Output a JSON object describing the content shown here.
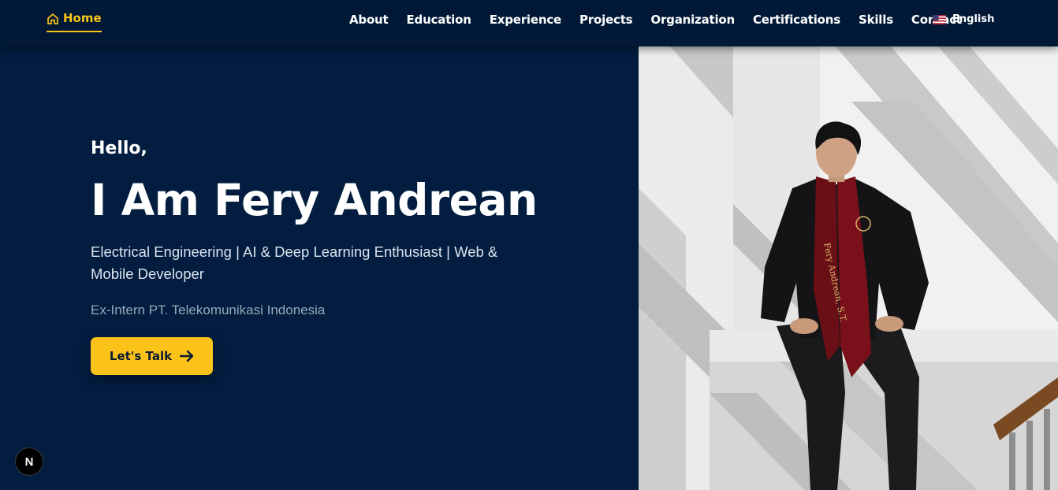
{
  "nav": {
    "home_label": "Home",
    "links": [
      "About",
      "Education",
      "Experience",
      "Projects",
      "Organization",
      "Certifications",
      "Skills",
      "Contact"
    ],
    "language": "English",
    "active_color": "#f9c51a"
  },
  "hero": {
    "greeting": "Hello,",
    "name": "I Am Fery Andrean",
    "subtitle": "Electrical Engineering | AI & Deep Learning Enthusiast | Web & Mobile Developer",
    "experience": "Ex-Intern PT. Telekomunikasi Indonesia",
    "cta_label": "Let's Talk",
    "accent": "#fbc21a",
    "background": "#021d3f"
  },
  "photo": {
    "stole_text": "Fery Andrean, S.T."
  },
  "badge": {
    "label": "N"
  }
}
